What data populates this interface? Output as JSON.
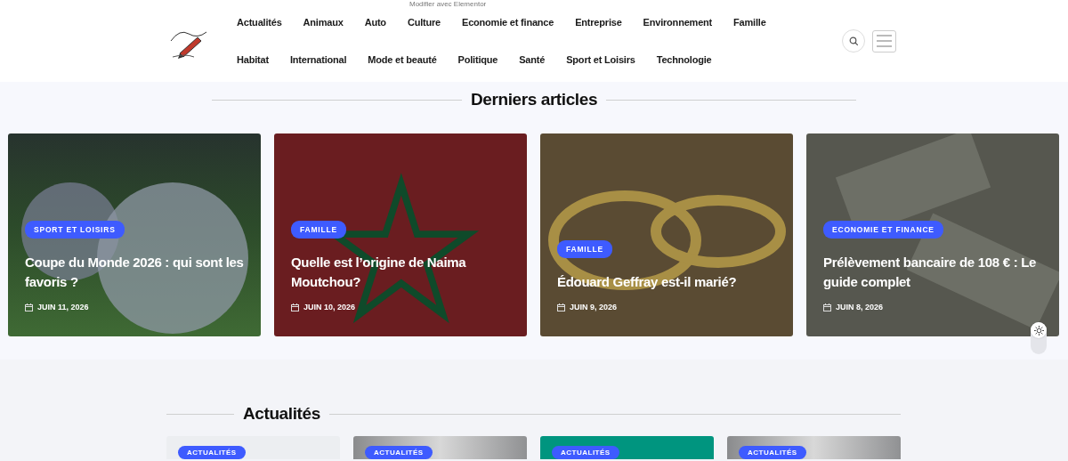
{
  "edit_link": "Modifier avec Elementor",
  "nav": {
    "items": [
      "Actualités",
      "Animaux",
      "Auto",
      "Culture",
      "Economie et finance",
      "Entreprise",
      "Environnement",
      "Famille",
      "Habitat",
      "International",
      "Mode et beauté",
      "Politique",
      "Santé",
      "Sport et Loisirs",
      "Technologie"
    ]
  },
  "latest": {
    "title": "Derniers articles",
    "articles": [
      {
        "category": "SPORT ET LOISIRS",
        "title": "Coupe du Monde 2026 : qui sont les favoris ?",
        "date": "JUIN 11, 2026",
        "kind": "stadium"
      },
      {
        "category": "FAMILLE",
        "title": "Quelle est l’origine de Naima Moutchou?",
        "date": "JUIN 10, 2026",
        "kind": "flag"
      },
      {
        "category": "FAMILLE",
        "title": "Édouard Geffray est-il marié?",
        "date": "JUIN 9, 2026",
        "kind": "rings"
      },
      {
        "category": "ECONOMIE ET FINANCE",
        "title": "Prélèvement bancaire de 108 € : Le guide complet",
        "date": "JUIN 8, 2026",
        "kind": "money"
      }
    ]
  },
  "news": {
    "title": "Actualités",
    "articles": [
      {
        "category": "ACTUALITÉS",
        "kind": "light"
      },
      {
        "category": "ACTUALITÉS",
        "kind": "grey"
      },
      {
        "category": "ACTUALITÉS",
        "kind": "teal"
      },
      {
        "category": "ACTUALITÉS",
        "kind": "grey"
      }
    ]
  }
}
